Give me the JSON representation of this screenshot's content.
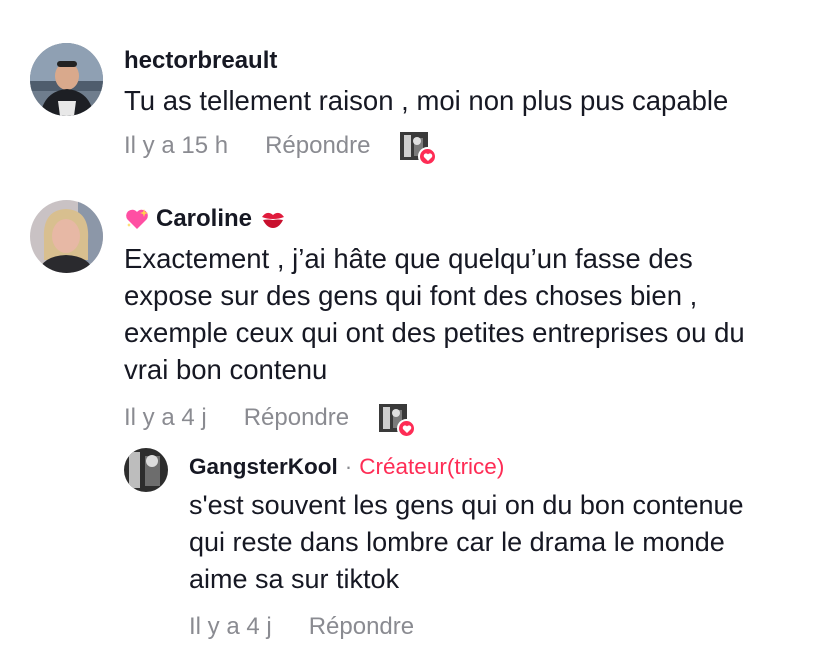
{
  "comments": [
    {
      "username": "hectorbreault",
      "text_lines": [
        "Tu as tellement raison , moi non plus pus capable"
      ],
      "time": "Il y a 15 h",
      "reply_label": "Répondre",
      "icons": {
        "liked_by_creator": "creator-liked-icon",
        "heart": "heart-icon"
      }
    },
    {
      "username": "Caroline",
      "icons": {
        "prefix": "sparkling-heart-emoji",
        "suffix": "kiss-mark-emoji",
        "liked_by_creator": "creator-liked-icon",
        "heart": "heart-icon"
      },
      "text_lines": [
        "Exactement , j’ai hâte que quelqu’un fasse des",
        "expose sur des gens qui font des choses bien ,",
        "exemple ceux qui ont des petites entreprises ou du",
        "vrai bon contenu"
      ],
      "time": "Il y a 4 j",
      "reply_label": "Répondre"
    }
  ],
  "reply": {
    "username": "GangsterKool",
    "separator": "·",
    "badge": "Créateur(trice)",
    "text_lines": [
      "s'est souvent les gens qui on du bon contenue",
      "qui reste dans lombre car le drama le monde",
      "aime sa sur tiktok"
    ],
    "time": "Il y a 4 j",
    "reply_label": "Répondre"
  },
  "colors": {
    "text": "#161823",
    "muted": "#8a8b91",
    "accent": "#fe2c55"
  }
}
